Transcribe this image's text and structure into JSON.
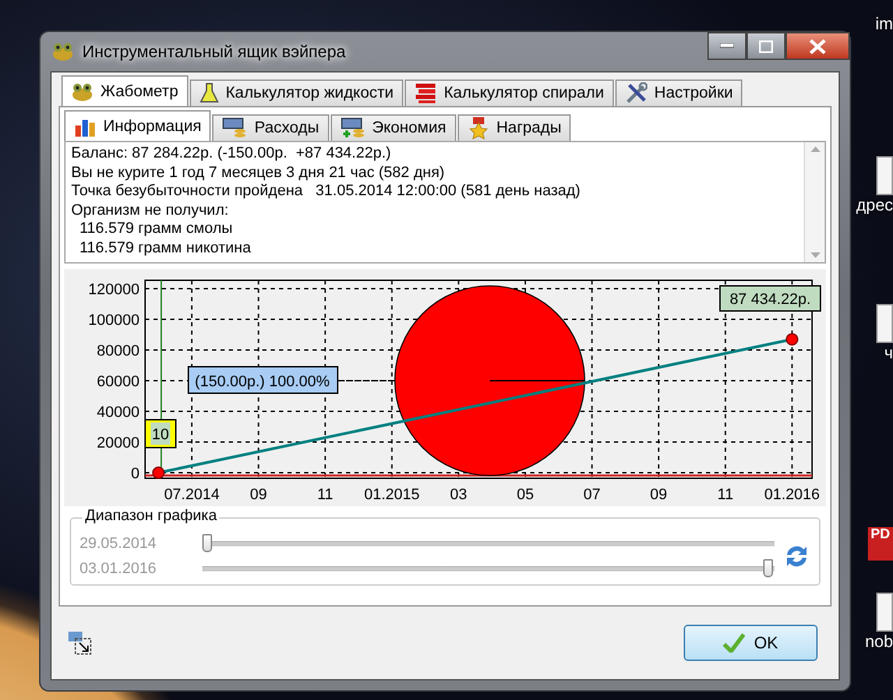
{
  "desktop_icons": [
    {
      "label": "im",
      "kind": "text"
    },
    {
      "label": "дрес",
      "kind": "document"
    },
    {
      "label": "ч",
      "kind": "document"
    },
    {
      "label": "PD",
      "kind": "pdf"
    },
    {
      "label": "nob",
      "kind": "document"
    }
  ],
  "window": {
    "title": "Инструментальный ящик вэйпера"
  },
  "tabs": [
    {
      "label": "Жабометр",
      "selected": true
    },
    {
      "label": "Калькулятор жидкости",
      "selected": false
    },
    {
      "label": "Калькулятор спирали",
      "selected": false
    },
    {
      "label": "Настройки",
      "selected": false
    }
  ],
  "subtabs": [
    {
      "label": "Информация",
      "selected": true
    },
    {
      "label": "Расходы",
      "selected": false
    },
    {
      "label": "Экономия",
      "selected": false
    },
    {
      "label": "Награды",
      "selected": false
    }
  ],
  "info": {
    "lines": [
      "Баланс: 87 284.22р. (-150.00р.  +87 434.22р.)",
      "Вы не курите 1 год 7 месяцев 3 дня 21 час (582 дня)",
      "Точка безубыточности пройдена   31.05.2014 12:00:00 (581 день назад)",
      "Организм не получил:"
    ],
    "sublines": [
      "116.579 грамм смолы",
      "116.579 грамм никотина"
    ]
  },
  "chart": {
    "end_label": "87 434.22р.",
    "pie_label": "(150.00р.) 100.00%",
    "marker_label": "10",
    "chart_data": {
      "type": "line",
      "grid": true,
      "categories": [
        null,
        "07.2014",
        null,
        "09",
        null,
        "11",
        null,
        "01.2015",
        null,
        "03",
        null,
        "05",
        null,
        "07",
        null,
        "09",
        null,
        "11",
        null,
        "01.2016"
      ],
      "ylim": [
        -3600,
        125500
      ],
      "yticks": [
        0,
        20000,
        40000,
        60000,
        80000,
        100000,
        120000
      ],
      "series": [
        {
          "color": "#008080",
          "marker": true,
          "values": [
            0,
            null,
            null,
            null,
            null,
            null,
            null,
            null,
            null,
            null,
            null,
            null,
            null,
            null,
            null,
            null,
            null,
            null,
            null,
            87000
          ]
        }
      ]
    }
  },
  "range": {
    "title": "Диапазон графика",
    "sliders": [
      {
        "label": "29.05.2014",
        "level": 0
      },
      {
        "label": "03.01.2016",
        "level": 1
      }
    ]
  },
  "buttons": [
    {
      "label": "OK"
    }
  ]
}
